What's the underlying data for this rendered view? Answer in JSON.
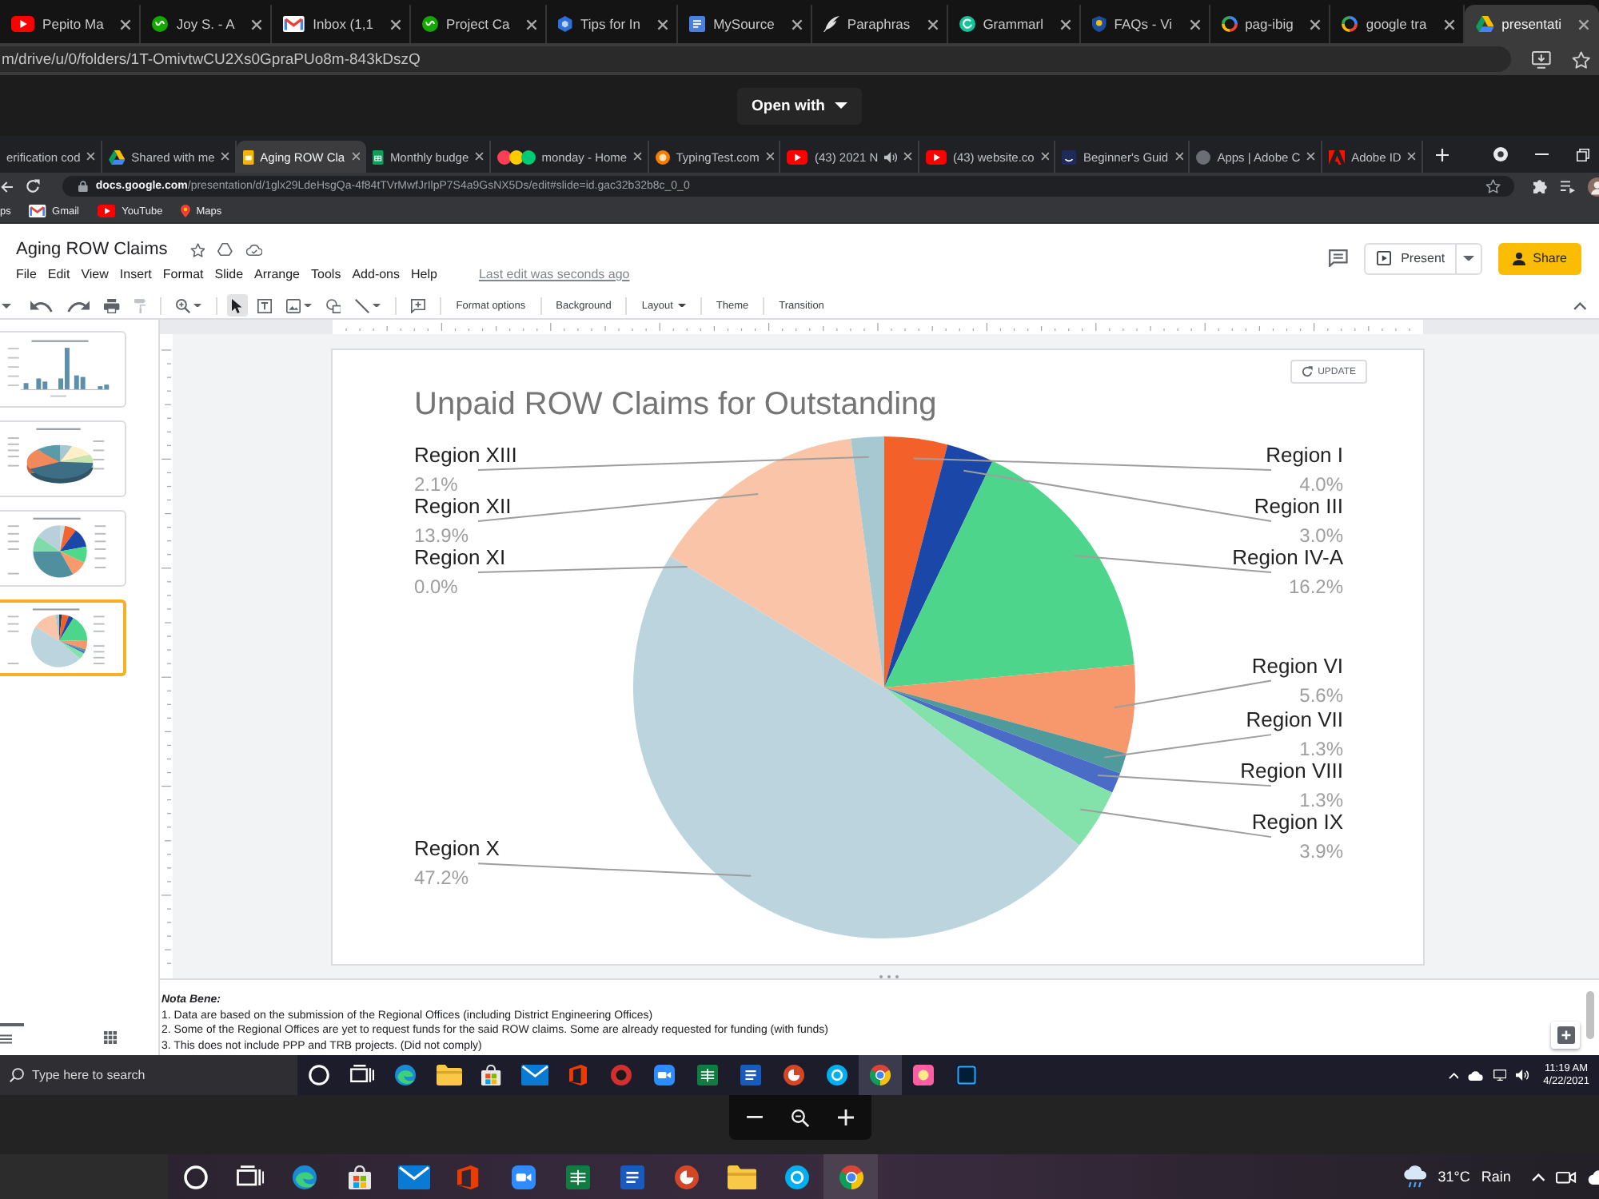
{
  "browser": {
    "tabs": [
      {
        "title": "Pepito Ma",
        "kind": "play",
        "selected": false
      },
      {
        "title": "Joy S. - A",
        "kind": "badge",
        "selected": false
      },
      {
        "title": "Inbox (1,1",
        "kind": "inbox",
        "selected": false
      },
      {
        "title": "Project Ca",
        "kind": "badge",
        "selected": false
      },
      {
        "title": "Tips for In",
        "kind": "hexagon",
        "selected": false
      },
      {
        "title": "MySource",
        "kind": "document",
        "selected": false
      },
      {
        "title": "Paraphras",
        "kind": "feather",
        "selected": false
      },
      {
        "title": "Grammarl",
        "kind": "arc",
        "selected": false
      },
      {
        "title": "FAQs - Vi",
        "kind": "shield",
        "selected": false
      },
      {
        "title": "pag-ibig",
        "kind": "ring",
        "selected": false
      },
      {
        "title": "google tra",
        "kind": "ring",
        "selected": false
      },
      {
        "title": "presentati",
        "kind": "triangle",
        "selected": true
      }
    ],
    "address": "m/drive/u/0/folders/1T-OmivtwCU2Xs0GpraPUo8m-843kDszQ"
  },
  "preview": {
    "open_with": "Open with"
  },
  "screenshot": {
    "tabs": [
      {
        "title": "erification cod",
        "selected": false,
        "audio": false
      },
      {
        "title": "Shared with me",
        "kind": "triangle",
        "selected": false,
        "audio": false
      },
      {
        "title": "Aging ROW Cla",
        "kind": "slides",
        "selected": true,
        "audio": false
      },
      {
        "title": "Monthly budge",
        "kind": "sheet",
        "selected": false,
        "audio": false
      },
      {
        "title": "monday - Home",
        "kind": "dots",
        "selected": false,
        "audio": false
      },
      {
        "title": "TypingTest.com",
        "kind": "target",
        "selected": false,
        "audio": false
      },
      {
        "title": "(43) 2021 N",
        "kind": "play",
        "selected": false,
        "audio": true
      },
      {
        "title": "(43) website.co",
        "kind": "play",
        "selected": false,
        "audio": false
      },
      {
        "title": "Beginner's Guid",
        "kind": "tile",
        "selected": false,
        "audio": false
      },
      {
        "title": "Apps | Adobe C",
        "kind": "circle",
        "selected": false,
        "audio": false
      },
      {
        "title": "Adobe ID",
        "kind": "peak",
        "selected": false,
        "audio": false
      }
    ],
    "address": "**docs.google.com**/presentation/d/1glx29LdeHsgQa-4f84tTVrMwfJrIlpP7S4a9GsNX5Ds/edit#slide=id.gac32b32b8c_0_0",
    "bookmarks": [
      {
        "label": "ps"
      },
      {
        "label": "Gmail",
        "kind": "inbox"
      },
      {
        "label": "YouTube",
        "kind": "play"
      },
      {
        "label": "Maps",
        "kind": "pin"
      }
    ],
    "slides": {
      "title": "Aging ROW Claims",
      "menu": [
        "File",
        "Edit",
        "View",
        "Insert",
        "Format",
        "Slide",
        "Arrange",
        "Tools",
        "Add-ons",
        "Help"
      ],
      "last_edit": "Last edit was seconds ago",
      "present": "Present",
      "share": "Share",
      "tools": [
        {
          "kind": "undo",
          "selected": false,
          "disabled": false,
          "menu": false
        },
        {
          "kind": "redo",
          "selected": false,
          "disabled": false,
          "menu": false
        },
        {
          "kind": "print",
          "selected": false,
          "disabled": false,
          "menu": false
        },
        {
          "kind": "paint",
          "selected": false,
          "disabled": true,
          "menu": false
        },
        {
          "kind": "zoom",
          "selected": false,
          "disabled": false,
          "menu": true
        },
        {
          "kind": "select",
          "selected": true,
          "disabled": false,
          "menu": false
        },
        {
          "kind": "textbox",
          "selected": false,
          "disabled": false,
          "menu": false
        },
        {
          "kind": "image",
          "selected": false,
          "disabled": false,
          "menu": true
        },
        {
          "kind": "shape",
          "selected": false,
          "disabled": false,
          "menu": false
        },
        {
          "kind": "line",
          "selected": false,
          "disabled": false,
          "menu": true
        },
        {
          "kind": "comment",
          "selected": false,
          "disabled": false,
          "menu": false
        }
      ],
      "toolbar_buttons": [
        {
          "label": "Format options",
          "menu": false
        },
        {
          "label": "Background",
          "menu": false
        },
        {
          "label": "Layout",
          "menu": true
        },
        {
          "label": "Theme",
          "menu": false
        },
        {
          "label": "Transition",
          "menu": false
        }
      ],
      "thumbnails": [
        {
          "kind": "bars",
          "selected": false
        },
        {
          "kind": "tilted",
          "selected": false
        },
        {
          "kind": "teal",
          "selected": false
        },
        {
          "kind": "pale",
          "selected": true
        }
      ],
      "slide": {
        "update": "UPDATE",
        "chart_data": {
          "type": "pie",
          "title": "Unpaid ROW Claims for Outstanding",
          "categories": [
            "Region I",
            "Region III",
            "Region IV-A",
            "Region VI",
            "Region VII",
            "Region VIII",
            "Region IX",
            "Region X",
            "Region XI",
            "Region XII",
            "Region XIII"
          ],
          "values": [
            4.0,
            3.0,
            16.2,
            5.6,
            1.3,
            1.3,
            3.9,
            47.2,
            0.0,
            13.9,
            2.1
          ],
          "value_labels": [
            "4.0%",
            "3.0%",
            "16.2%",
            "5.6%",
            "1.3%",
            "1.3%",
            "3.9%",
            "47.2%",
            "0.0%",
            "13.9%",
            "2.1%"
          ]
        }
      },
      "notes": {
        "heading": "Nota Bene:",
        "lines": [
          "1. Data are based on the submission of the Regional Offices (including District Engineering Offices)",
          "2. Some of the Regional Offices are yet to request funds for the said ROW claims. Some are already requested for funding (with funds)",
          "3. This does not include PPP and TRB projects. (Did not comply)"
        ]
      }
    },
    "taskbar": {
      "placeholder": "Type here to search",
      "apps": [
        {
          "kind": "orb",
          "selected": false
        },
        {
          "kind": "taskview",
          "selected": false
        },
        {
          "kind": "swirl",
          "selected": false
        },
        {
          "kind": "folder",
          "selected": false
        },
        {
          "kind": "bag",
          "selected": false
        },
        {
          "kind": "envelope",
          "selected": false
        },
        {
          "kind": "office",
          "selected": false
        },
        {
          "kind": "disc",
          "selected": false
        },
        {
          "kind": "video",
          "selected": false
        },
        {
          "kind": "grid",
          "selected": false
        },
        {
          "kind": "lines",
          "selected": false
        },
        {
          "kind": "wedge",
          "selected": false
        },
        {
          "kind": "bubble",
          "selected": false
        },
        {
          "kind": "wheel",
          "selected": true
        },
        {
          "kind": "bloom",
          "selected": false
        },
        {
          "kind": "frame",
          "selected": false
        }
      ],
      "time": "11:19 AM",
      "date": "4/22/2021"
    }
  },
  "taskbar": {
    "apps": [
      {
        "kind": "orb",
        "selected": false
      },
      {
        "kind": "taskview",
        "selected": false
      },
      {
        "kind": "swirl",
        "selected": false
      },
      {
        "kind": "bag",
        "selected": false
      },
      {
        "kind": "envelope",
        "selected": false
      },
      {
        "kind": "office",
        "selected": false
      },
      {
        "kind": "video",
        "selected": false
      },
      {
        "kind": "grid",
        "selected": false
      },
      {
        "kind": "lines",
        "selected": false
      },
      {
        "kind": "wedge",
        "selected": false
      },
      {
        "kind": "folder",
        "selected": false
      },
      {
        "kind": "bubble",
        "selected": false
      },
      {
        "kind": "wheel",
        "selected": true
      }
    ],
    "temperature": "31°C",
    "weather": "Rain"
  }
}
